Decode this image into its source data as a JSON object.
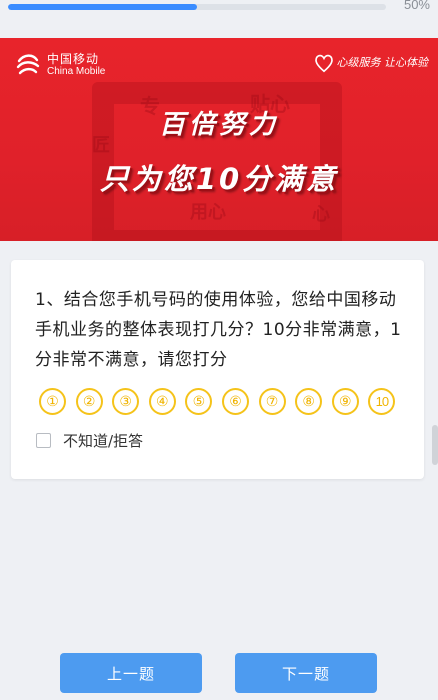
{
  "progress": {
    "percent_label": "50%",
    "fraction": 0.5
  },
  "banner": {
    "brand_cn": "中国移动",
    "brand_en": "China Mobile",
    "right_logo": "心级服务 让心体验",
    "slogan_line1": "百倍努力",
    "slogan_line2": "只为您10分满意",
    "bg_glyphs": [
      "专",
      "贴心",
      "匠",
      "用心",
      "心"
    ]
  },
  "question": {
    "text": "1、结合您手机号码的使用体验，您给中国移动手机业务的整体表现打几分？10分非常满意，1分非常不满意，请您打分",
    "scores": [
      "①",
      "②",
      "③",
      "④",
      "⑤",
      "⑥",
      "⑦",
      "⑧",
      "⑨",
      "10"
    ],
    "dont_know_label": "不知道/拒答"
  },
  "buttons": {
    "prev_label": "上一题",
    "next_label": "下一题"
  },
  "colors": {
    "accent": "#4d9bf0",
    "banner_red": "#e8242b",
    "score_yellow": "#f5c31a",
    "progress_blue": "#3a8cff"
  }
}
